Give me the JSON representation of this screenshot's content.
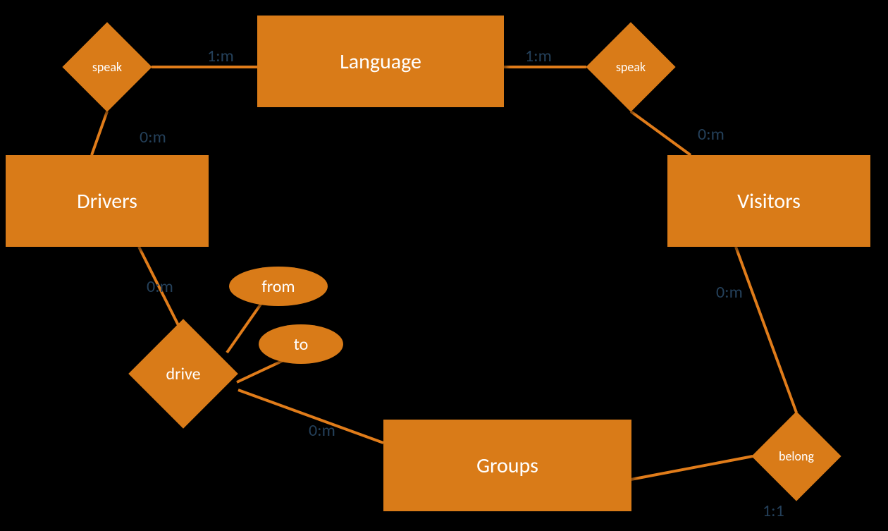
{
  "diagram": {
    "type": "ER",
    "entities": {
      "language": {
        "label": "Language"
      },
      "drivers": {
        "label": "Drivers"
      },
      "visitors": {
        "label": "Visitors"
      },
      "groups": {
        "label": "Groups"
      }
    },
    "relationships": {
      "speak_left": {
        "label": "speak",
        "connects": [
          "drivers",
          "language"
        ]
      },
      "speak_right": {
        "label": "speak",
        "connects": [
          "visitors",
          "language"
        ]
      },
      "drive": {
        "label": "drive",
        "connects": [
          "drivers",
          "groups"
        ],
        "attributes": [
          "from",
          "to"
        ]
      },
      "belong": {
        "label": "belong",
        "connects": [
          "visitors",
          "groups"
        ]
      }
    },
    "attributes": {
      "from": {
        "label": "from"
      },
      "to": {
        "label": "to"
      }
    },
    "cardinalities": {
      "speak_left_language": "1:m",
      "speak_left_drivers": "0:m",
      "speak_right_language": "1:m",
      "speak_right_visitors": "0:m",
      "drive_drivers": "0:m",
      "drive_groups": "0:m",
      "belong_visitors": "0:m",
      "belong_groups": "1:1"
    },
    "colors": {
      "fill": "#d97b18",
      "stroke": "#e07c1a",
      "label": "#24405a"
    }
  }
}
